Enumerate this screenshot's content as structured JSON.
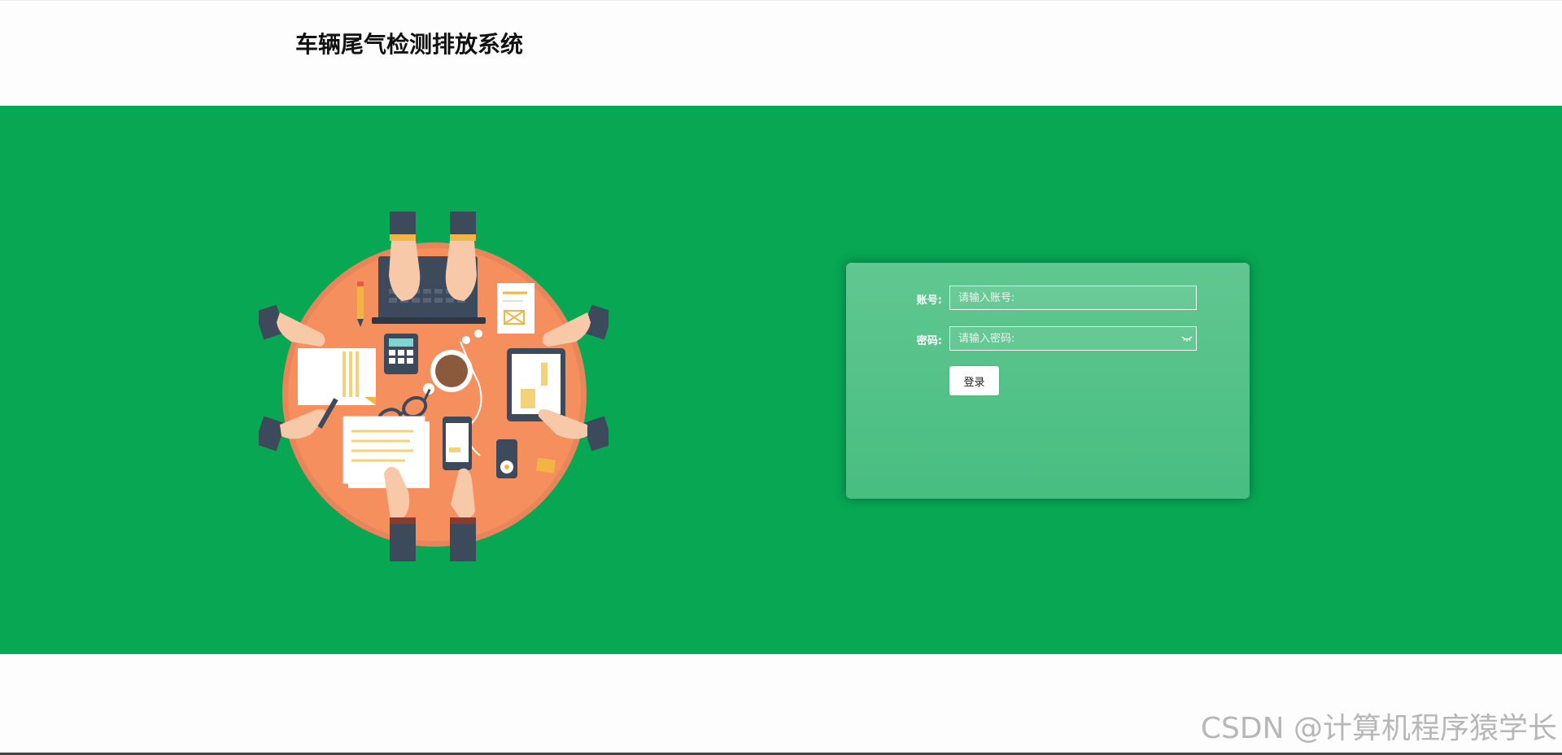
{
  "header": {
    "title": "车辆尾气检测排放系统"
  },
  "hero": {
    "background_color": "#08a754"
  },
  "login": {
    "account_label": "账号:",
    "account_placeholder": "请输入账号:",
    "password_label": "密码:",
    "password_placeholder": "请输入密码:",
    "submit_label": "登录"
  },
  "watermark": {
    "text": "CSDN @计算机程序猿学长"
  },
  "colors": {
    "table": "#f5905e",
    "sleeve": "#3d4a5c",
    "skin": "#f8c9a8"
  }
}
